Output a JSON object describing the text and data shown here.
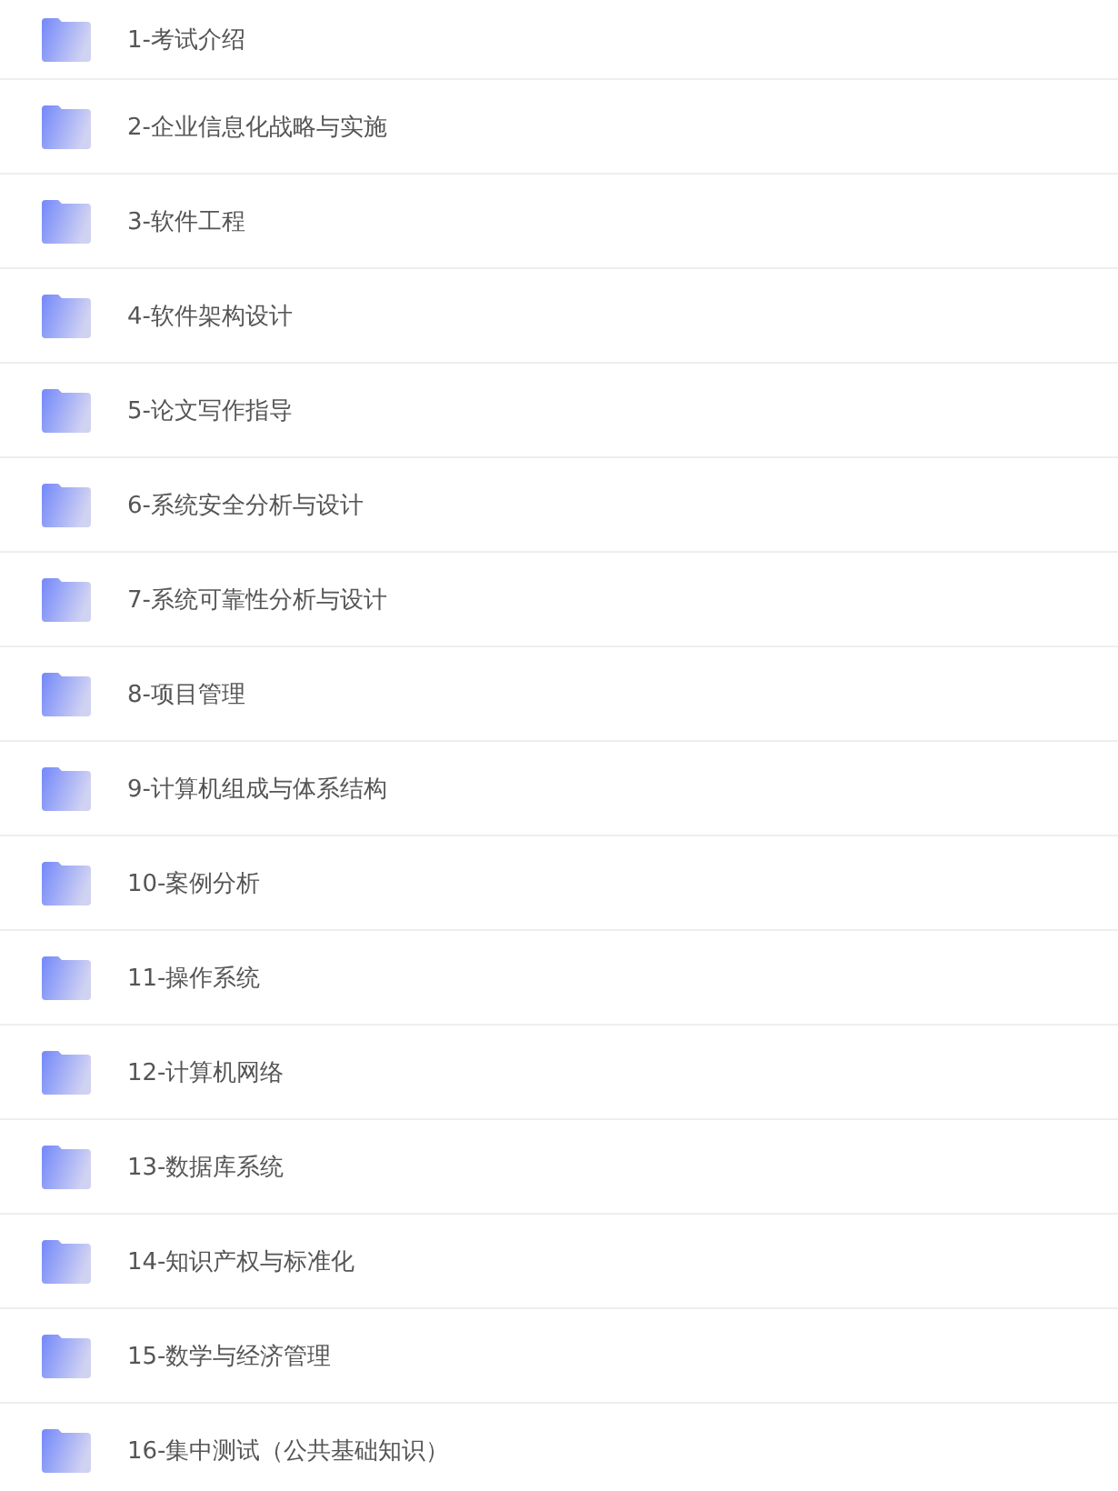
{
  "folders": [
    {
      "label": "1-考试介绍"
    },
    {
      "label": "2-企业信息化战略与实施"
    },
    {
      "label": "3-软件工程"
    },
    {
      "label": "4-软件架构设计"
    },
    {
      "label": "5-论文写作指导"
    },
    {
      "label": "6-系统安全分析与设计"
    },
    {
      "label": "7-系统可靠性分析与设计"
    },
    {
      "label": "8-项目管理"
    },
    {
      "label": "9-计算机组成与体系结构"
    },
    {
      "label": "10-案例分析"
    },
    {
      "label": "11-操作系统"
    },
    {
      "label": "12-计算机网络"
    },
    {
      "label": "13-数据库系统"
    },
    {
      "label": "14-知识产权与标准化"
    },
    {
      "label": "15-数学与经济管理"
    },
    {
      "label": "16-集中测试（公共基础知识）"
    }
  ]
}
